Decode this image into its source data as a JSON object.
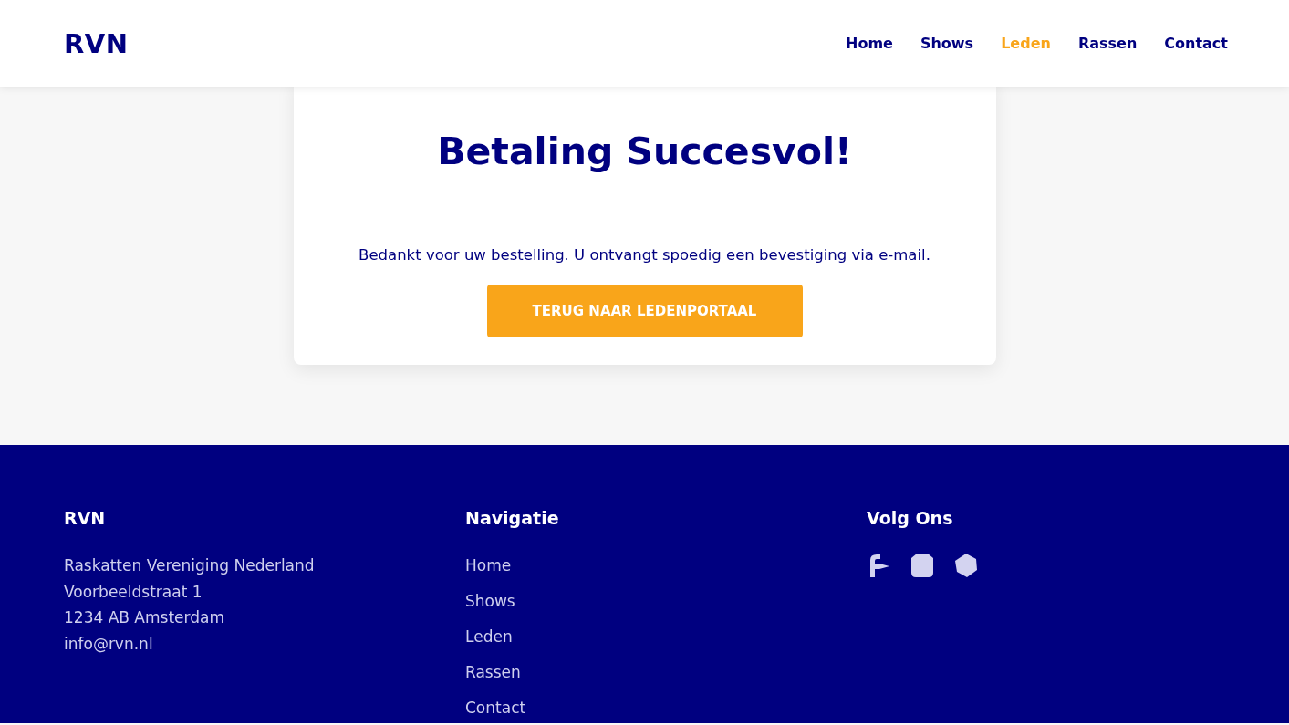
{
  "header": {
    "logo": "RVN",
    "nav": [
      {
        "label": "Home",
        "selected": false
      },
      {
        "label": "Shows",
        "selected": false
      },
      {
        "label": "Leden",
        "selected": true
      },
      {
        "label": "Rassen",
        "selected": false
      },
      {
        "label": "Contact",
        "selected": false
      }
    ]
  },
  "card": {
    "title": "Betaling Succesvol!",
    "message": "Bedankt voor uw bestelling. U ontvangt spoedig een bevestiging via e-mail.",
    "button": "TERUG NAAR LEDENPORTAAL"
  },
  "footer": {
    "columns": [
      {
        "kind": "address",
        "heading": "RVN",
        "lines": [
          "Raskatten Vereniging Nederland",
          "Voorbeeldstraat 1",
          "1234 AB Amsterdam",
          "info@rvn.nl"
        ]
      },
      {
        "kind": "links",
        "heading": "Navigatie",
        "links": [
          "Home",
          "Shows",
          "Leden",
          "Rassen",
          "Contact"
        ]
      },
      {
        "kind": "social",
        "heading": "Volg Ons"
      }
    ]
  }
}
